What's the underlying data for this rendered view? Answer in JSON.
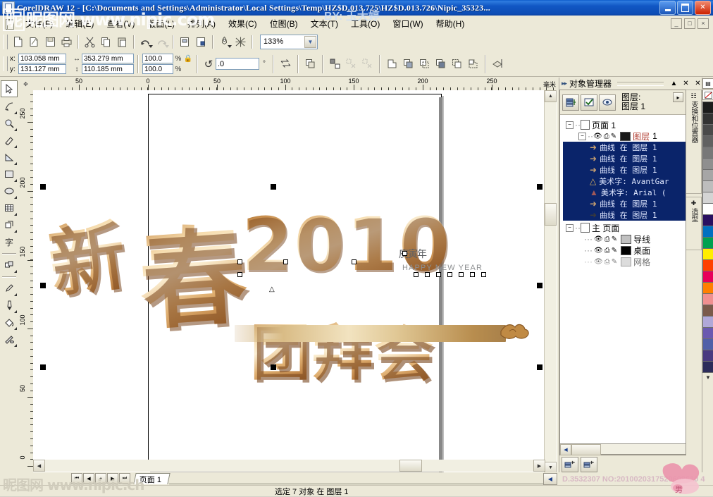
{
  "window": {
    "title": "CorelDRAW 12 - [C:\\Documents and Settings\\Administrator\\Local Settings\\Temp\\HZ$D.013.725\\HZ$D.013.726\\Nipic_35323...",
    "app_icon": "coreldraw-icon",
    "minimize": "minimize-icon",
    "restore": "restore-icon",
    "close": "close-icon",
    "mdi_minimize": "_",
    "mdi_restore": "□",
    "mdi_close": "×"
  },
  "menu": {
    "items": [
      {
        "label": "文件(F)",
        "name": "menu-file"
      },
      {
        "label": "编辑(E)",
        "name": "menu-edit"
      },
      {
        "label": "查看(V)",
        "name": "menu-view"
      },
      {
        "label": "版面(L)",
        "name": "menu-layout"
      },
      {
        "label": "排列(A)",
        "name": "menu-arrange"
      },
      {
        "label": "效果(C)",
        "name": "menu-effects"
      },
      {
        "label": "位图(B)",
        "name": "menu-bitmaps"
      },
      {
        "label": "文本(T)",
        "name": "menu-text"
      },
      {
        "label": "工具(O)",
        "name": "menu-tools"
      },
      {
        "label": "窗口(W)",
        "name": "menu-window"
      },
      {
        "label": "帮助(H)",
        "name": "menu-help"
      }
    ]
  },
  "toolbar": {
    "buttons": [
      {
        "name": "new-icon",
        "glyph": "❐"
      },
      {
        "name": "open-icon",
        "glyph": "❐"
      },
      {
        "name": "save-icon",
        "glyph": "❑"
      },
      {
        "name": "print-icon",
        "glyph": "⎙"
      },
      {
        "name": "cut-icon",
        "glyph": "✂"
      },
      {
        "name": "copy-icon",
        "glyph": "❐"
      },
      {
        "name": "paste-icon",
        "glyph": "❑"
      },
      {
        "name": "undo-icon",
        "glyph": "↶"
      },
      {
        "name": "redo-icon",
        "glyph": "↷"
      },
      {
        "name": "import-icon",
        "glyph": "◧"
      },
      {
        "name": "export-icon",
        "glyph": "◨"
      },
      {
        "name": "application-launcher-icon",
        "glyph": "⚑"
      },
      {
        "name": "corel-online-icon",
        "glyph": "❄"
      }
    ],
    "zoom_level": "133%",
    "zoom_dropdown_icon": "chevron-down-icon"
  },
  "property_bar": {
    "x_label": "x:",
    "y_label": "y:",
    "x_value": "103.058 mm",
    "y_value": "131.127 mm",
    "width_value": "353.279 mm",
    "height_value": "110.185 mm",
    "scale_h": "100.0",
    "scale_v": "100.0",
    "percent_symbol": "%",
    "lock_icon": "lock-ratio-icon",
    "rotation_value": ".0",
    "degree_symbol": "°",
    "width_icon": "width-icon",
    "height_icon": "height-icon",
    "rotate_icon": "rotate-icon",
    "right_buttons": [
      {
        "name": "mirror-horizontal-icon",
        "glyph": "⇋"
      },
      {
        "name": "group-icon",
        "glyph": "◱"
      },
      {
        "name": "ungroup-icon",
        "glyph": "⁙"
      },
      {
        "name": "ungroup-all-icon",
        "glyph": "✕"
      },
      {
        "name": "weld-icon",
        "glyph": "❐"
      },
      {
        "name": "trim-icon",
        "glyph": "◩"
      },
      {
        "name": "intersect-icon",
        "glyph": "◫"
      },
      {
        "name": "simplify-icon",
        "glyph": "◰"
      },
      {
        "name": "front-minus-back-icon",
        "glyph": "◳"
      },
      {
        "name": "back-minus-front-icon",
        "glyph": "◲"
      },
      {
        "name": "wireframe-icon",
        "glyph": "⧉"
      }
    ]
  },
  "toolbox": {
    "tools": [
      {
        "name": "pick-tool",
        "glyph": "➤",
        "selected": true,
        "flyout": false
      },
      {
        "name": "shape-tool",
        "glyph": "✠",
        "selected": false,
        "flyout": true
      },
      {
        "name": "zoom-tool",
        "glyph": "⌕",
        "selected": false,
        "flyout": true
      },
      {
        "name": "freehand-tool",
        "glyph": "✎",
        "selected": false,
        "flyout": true
      },
      {
        "name": "smart-drawing-tool",
        "glyph": "◿",
        "selected": false,
        "flyout": true
      },
      {
        "name": "rectangle-tool",
        "glyph": "▭",
        "selected": false,
        "flyout": true
      },
      {
        "name": "ellipse-tool",
        "glyph": "⬭",
        "selected": false,
        "flyout": true
      },
      {
        "name": "graph-paper-tool",
        "glyph": "▒",
        "selected": false,
        "flyout": true
      },
      {
        "name": "polygon-tool",
        "glyph": "⬠",
        "selected": false,
        "flyout": true
      },
      {
        "name": "text-tool",
        "glyph": "字",
        "selected": false,
        "flyout": false
      },
      {
        "name": "interactive-blend-tool",
        "glyph": "❐",
        "selected": false,
        "flyout": true
      },
      {
        "name": "eyedropper-tool",
        "glyph": "✐",
        "selected": false,
        "flyout": true
      },
      {
        "name": "outline-tool",
        "glyph": "✒",
        "selected": false,
        "flyout": true
      },
      {
        "name": "fill-tool",
        "glyph": "◢",
        "selected": false,
        "flyout": true
      },
      {
        "name": "interactive-fill-tool",
        "glyph": "◣",
        "selected": false,
        "flyout": true
      }
    ]
  },
  "rulers": {
    "unit": "毫米",
    "horizontal_ticks": [
      "50",
      "0",
      "50",
      "100",
      "150",
      "200",
      "250"
    ],
    "vertical_ticks": [
      "250",
      "200",
      "150",
      "100",
      "50",
      "0"
    ]
  },
  "artwork": {
    "headline_chars": [
      "新",
      "春",
      "团",
      "拜",
      "会"
    ],
    "year": "2010",
    "chinese_year": "庚寅年",
    "english": "HAPPY NEW YEAR",
    "cloud_icon": "cloud-ornament-icon",
    "ribbon_name": "gold-ribbon"
  },
  "docker": {
    "title": "对象管理器",
    "grip_icon": "docker-grip-icon",
    "collapse_icon": "collapse-icon",
    "close_icon": "close-icon",
    "dock_close_icon": "dock-close-icon",
    "header": {
      "buttons": [
        {
          "name": "new-layer-icon",
          "glyph": "≣"
        },
        {
          "name": "layer-manager-view-icon",
          "glyph": "✓"
        },
        {
          "name": "edit-across-layers-icon",
          "glyph": "◉"
        }
      ],
      "layer_label_line1": "图层:",
      "layer_label_line2": "图层 1",
      "expand_icon": "expand-icon"
    },
    "tree": {
      "page_node": "页面 1",
      "layer_node": "图层",
      "layer_node_num": "1",
      "objects": [
        {
          "label": "曲线 在 图层 1",
          "icon": "curve-icon",
          "selected": true
        },
        {
          "label": "曲线 在 图层 1",
          "icon": "curve-icon",
          "selected": true
        },
        {
          "label": "曲线 在 图层 1",
          "icon": "curve-icon",
          "selected": true
        },
        {
          "label": "美术字: AvantGar",
          "icon": "artistic-text-icon",
          "selected": true
        },
        {
          "label": "美术字: Arial (",
          "icon": "artistic-text-icon",
          "selected": true
        },
        {
          "label": "曲线 在 图层 1",
          "icon": "curve-icon",
          "selected": true
        },
        {
          "label": "曲线 在 图层 1",
          "icon": "curve-icon",
          "selected": true
        }
      ],
      "master_page": "主 页面",
      "master_layers": [
        {
          "label": "导线",
          "swatch": "#c0c0c0",
          "visible": true
        },
        {
          "label": "桌面",
          "swatch": "#000000",
          "visible": true
        },
        {
          "label": "网格",
          "swatch": "#c0c0c0",
          "visible": false
        }
      ]
    },
    "bottom_buttons": [
      {
        "name": "new-layer-button-icon",
        "glyph": "✦"
      },
      {
        "name": "new-master-layer-button-icon",
        "glyph": "✦"
      }
    ],
    "scroll_left_icon": "scroll-left-icon",
    "side_tabs": [
      {
        "name": "docker-tab-transformations",
        "label": "变换和位置器",
        "icon": "transform-icon"
      },
      {
        "name": "docker-tab-shaping",
        "label": "造型",
        "icon": "shaping-icon"
      }
    ]
  },
  "palette": {
    "top_icon": "palette-options-icon",
    "no_color_icon": "no-color-icon",
    "more_icon": "more-colors-icon",
    "colors": [
      "#1c1c1c",
      "#333333",
      "#4a4a4a",
      "#616161",
      "#787878",
      "#8f8f8f",
      "#a6a6a6",
      "#bdbdbd",
      "#d4d4d4",
      "#ffffff",
      "#2a1060",
      "#0070c0",
      "#00a050",
      "#ffee00",
      "#ff4000",
      "#e8005a",
      "#ff8000",
      "#f09090",
      "#7a5a4a",
      "#b0a8d8",
      "#6a5ab0",
      "#5060a8",
      "#4a3a80",
      "#2c2c5a"
    ]
  },
  "page_tabs": {
    "first_icon": "first-page-icon",
    "prev_icon": "prev-page-icon",
    "add_icon": "add-page-icon",
    "next_icon": "next-page-icon",
    "last_icon": "last-page-icon",
    "tab_label": "页面 1",
    "scroll_icon": "scroll-left-icon"
  },
  "status_bar": {
    "text": "选定 7 对象 在 图层 1"
  },
  "watermarks": {
    "top_left": "昵图网 www.nipic.com",
    "top_left_box": "昵",
    "top_center": "BY: 玉大婷",
    "bottom_left": "昵图网 www.nipic.ch",
    "bottom_right": "D.3532307 NO:2010020317520608610 4"
  },
  "colors": {
    "titlebar": "#0d4db5",
    "chrome": "#ece9d8",
    "selection": "#0a246a",
    "gold": "#d9b071"
  }
}
